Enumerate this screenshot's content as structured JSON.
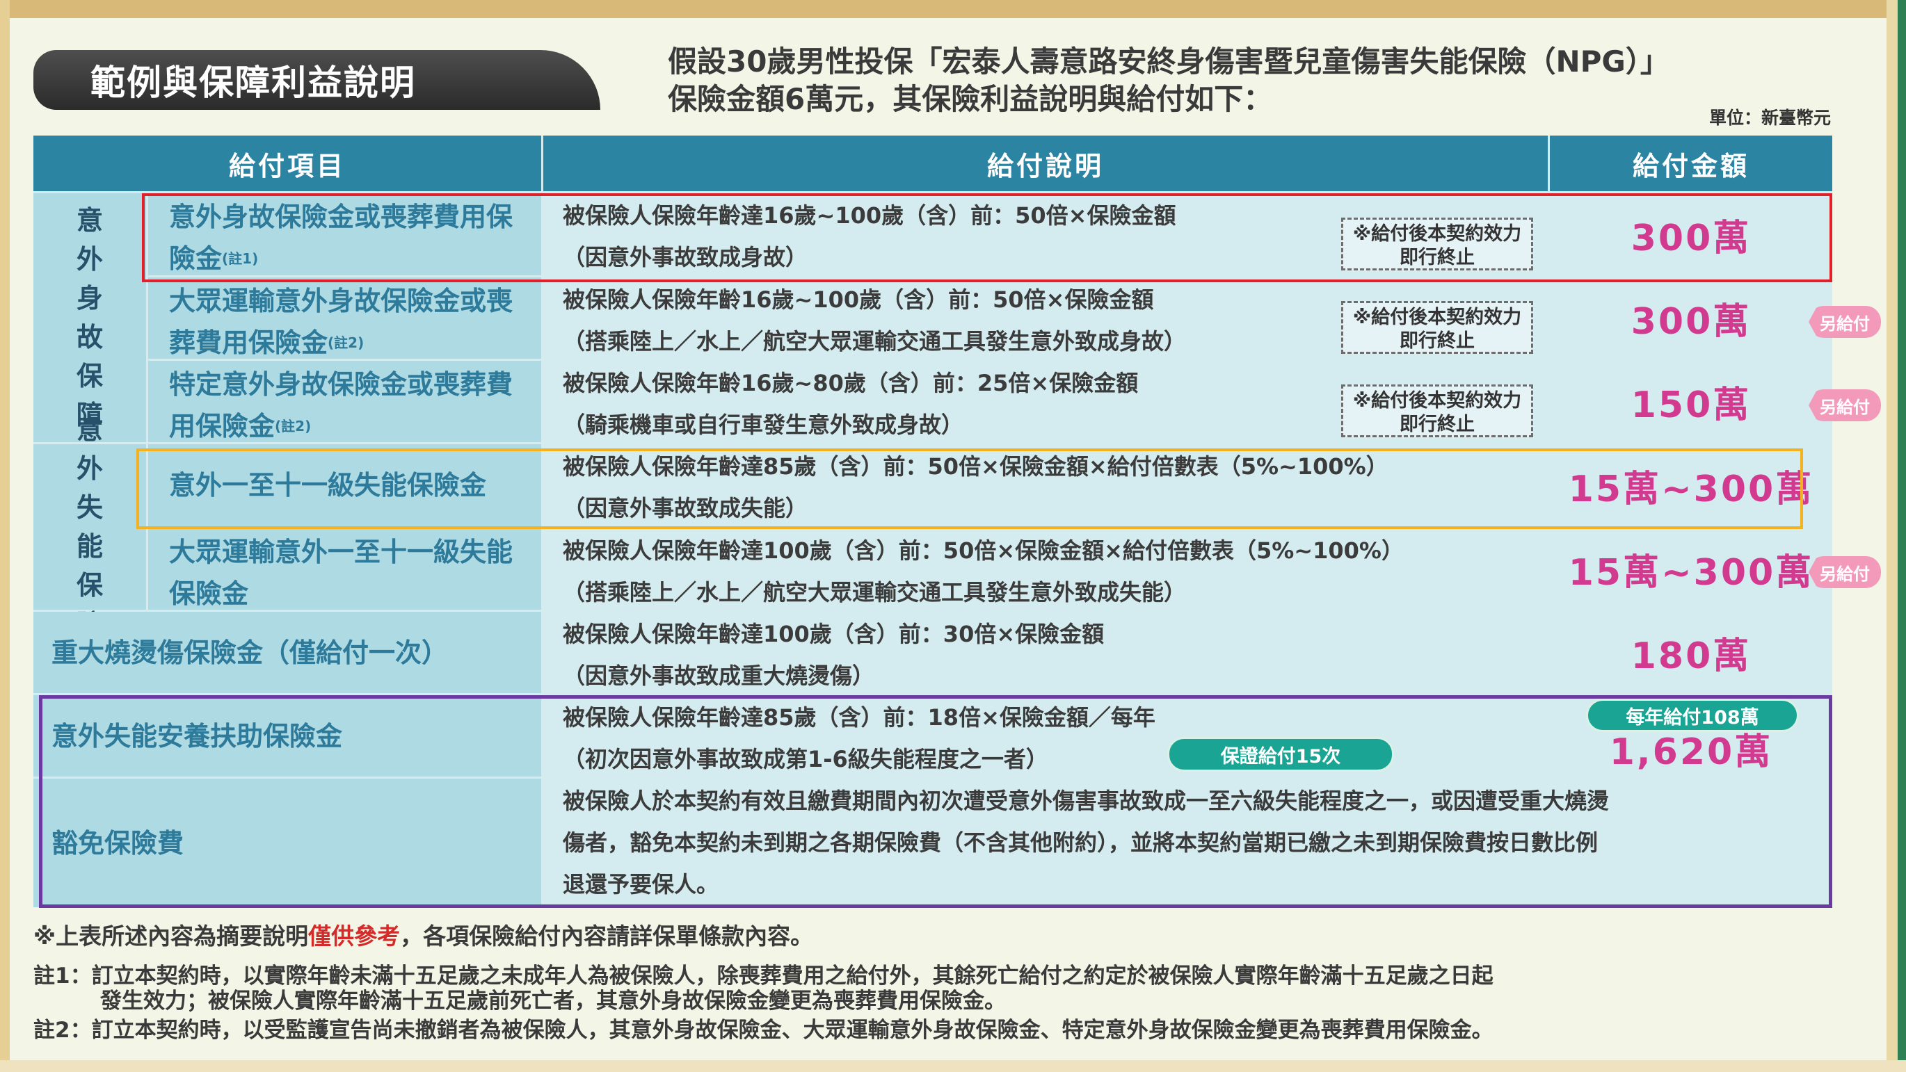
{
  "section_title": "範例與保障利益說明",
  "intro": {
    "line1": "假設30歲男性投保「宏泰人壽意路安終身傷害暨兒童傷害失能保險（NPG）」",
    "line2": "保險金額6萬元，其保險利益說明與給付如下："
  },
  "unit": "單位：新臺幣元",
  "table": {
    "headers": [
      "給付項目",
      "給付說明",
      "給付金額"
    ],
    "category_death": "意外身故保障",
    "category_disability": "意外失能保障",
    "termination_note": "※給付後本契約效力即行終止",
    "double_tag": "另給付",
    "rows": [
      {
        "item": "意外身故保險金或喪葬費用保險金",
        "note": "(註1)",
        "desc1": "被保險人保險年齡達16歲~100歲（含）前：50倍×保險金額",
        "desc2": "（因意外事故致成身故）",
        "amount": "300萬"
      },
      {
        "item": "大眾運輸意外身故保險金或喪葬費用保險金",
        "note": "(註2)",
        "desc1": "被保險人保險年齡16歲~100歲（含）前：50倍×保險金額",
        "desc2": "（搭乘陸上／水上／航空大眾運輸交通工具發生意外致成身故）",
        "amount": "300萬"
      },
      {
        "item": "特定意外身故保險金或喪葬費用保險金",
        "note": "(註2)",
        "desc1": "被保險人保險年齡16歲~80歲（含）前：25倍×保險金額",
        "desc2": "（騎乘機車或自行車發生意外致成身故）",
        "amount": "150萬"
      },
      {
        "item": "意外一至十一級失能保險金",
        "desc1": "被保險人保險年齡達85歲（含）前：50倍×保險金額×給付倍數表（5%~100%）",
        "desc2": "（因意外事故致成失能）",
        "amount": "15萬~300萬"
      },
      {
        "item": "大眾運輸意外一至十一級失能保險金",
        "desc1": "被保險人保險年齡達100歲（含）前：50倍×保險金額×給付倍數表（5%~100%）",
        "desc2": "（搭乘陸上／水上／航空大眾運輸交通工具發生意外致成失能）",
        "amount": "15萬~300萬"
      },
      {
        "item": "重大燒燙傷保險金（僅給付一次）",
        "desc1": "被保險人保險年齡達100歲（含）前：30倍×保險金額",
        "desc2": "（因意外事故致成重大燒燙傷）",
        "amount": "180萬"
      },
      {
        "item": "意外失能安養扶助保險金",
        "desc1": "被保險人保險年齡達85歲（含）前：18倍×保險金額／每年",
        "desc2": "（初次因意外事故致成第1-6級失能程度之一者）",
        "guarantee_pill": "保證給付15次",
        "annual_pill": "每年給付108萬",
        "amount": "1,620萬"
      },
      {
        "item": "豁免保險費",
        "desc1": "被保險人於本契約有效且繳費期間內初次遭受意外傷害事故致成一至六級失能程度之一，或因遭受重大燒燙",
        "desc2": "傷者，豁免本契約未到期之各期保險費（不含其他附約），並將本契約當期已繳之未到期保險費按日數比例",
        "desc3": "退還予要保人。"
      }
    ]
  },
  "footer": {
    "disclaimer_pre": "※上表所述內容為摘要說明",
    "disclaimer_red": "僅供參考",
    "disclaimer_post": "，各項保險給付內容請詳保單條款內容。",
    "note1_a": "註1：訂立本契約時，以實際年齡未滿十五足歲之未成年人為被保險人，除喪葬費用之給付外，其餘死亡給付之約定於被保險人實際年齡滿十五足歲之日起",
    "note1_b": "發生效力；被保險人實際年齡滿十五足歲前死亡者，其意外身故保險金變更為喪葬費用保險金。",
    "note2": "註2：訂立本契約時，以受監護宣告尚未撤銷者為被保險人，其意外身故保險金、大眾運輸意外身故保險金、特定意外身故保險金變更為喪葬費用保險金。"
  },
  "colors": {
    "header_bg": "#2c84a3",
    "amount_text": "#d13a8e",
    "highlight_red": "#e0212b",
    "highlight_yellow": "#f4b21f",
    "highlight_purple": "#6a3aa0"
  }
}
